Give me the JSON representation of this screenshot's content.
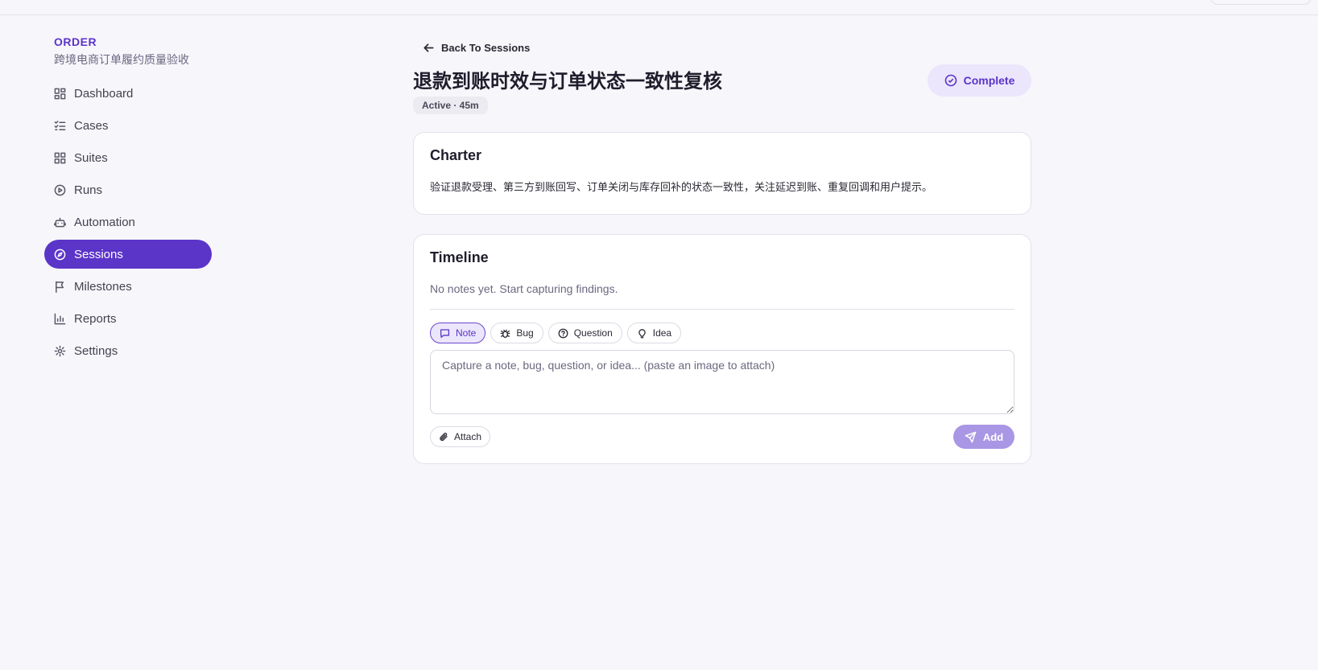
{
  "sidebar": {
    "brand_title": "ORDER",
    "brand_subtitle": "跨境电商订单履约质量验收",
    "items": [
      {
        "label": "Dashboard",
        "icon": "dashboard-icon"
      },
      {
        "label": "Cases",
        "icon": "list-check-icon"
      },
      {
        "label": "Suites",
        "icon": "grid-icon"
      },
      {
        "label": "Runs",
        "icon": "play-circle-icon"
      },
      {
        "label": "Automation",
        "icon": "robot-icon"
      },
      {
        "label": "Sessions",
        "icon": "compass-icon",
        "active": true
      },
      {
        "label": "Milestones",
        "icon": "flag-icon"
      },
      {
        "label": "Reports",
        "icon": "bar-chart-icon"
      },
      {
        "label": "Settings",
        "icon": "gear-icon"
      }
    ]
  },
  "header": {
    "back_label": "Back To Sessions",
    "title": "退款到账时效与订单状态一致性复核",
    "status": "Active · 45m",
    "complete_label": "Complete"
  },
  "charter": {
    "title": "Charter",
    "text": "验证退款受理、第三方到账回写、订单关闭与库存回补的状态一致性，关注延迟到账、重复回调和用户提示。"
  },
  "timeline": {
    "title": "Timeline",
    "empty_text": "No notes yet. Start capturing findings.",
    "types": [
      {
        "label": "Note",
        "icon": "message-icon",
        "selected": true
      },
      {
        "label": "Bug",
        "icon": "bug-icon"
      },
      {
        "label": "Question",
        "icon": "help-circle-icon"
      },
      {
        "label": "Idea",
        "icon": "lightbulb-icon"
      }
    ],
    "input_placeholder": "Capture a note, bug, question, or idea... (paste an image to attach)",
    "attach_label": "Attach",
    "add_label": "Add"
  },
  "colors": {
    "accent": "#5b34c8",
    "accent_soft": "#ebe6fb",
    "add_disabled": "#a996e4",
    "background": "#f7f6fb"
  }
}
